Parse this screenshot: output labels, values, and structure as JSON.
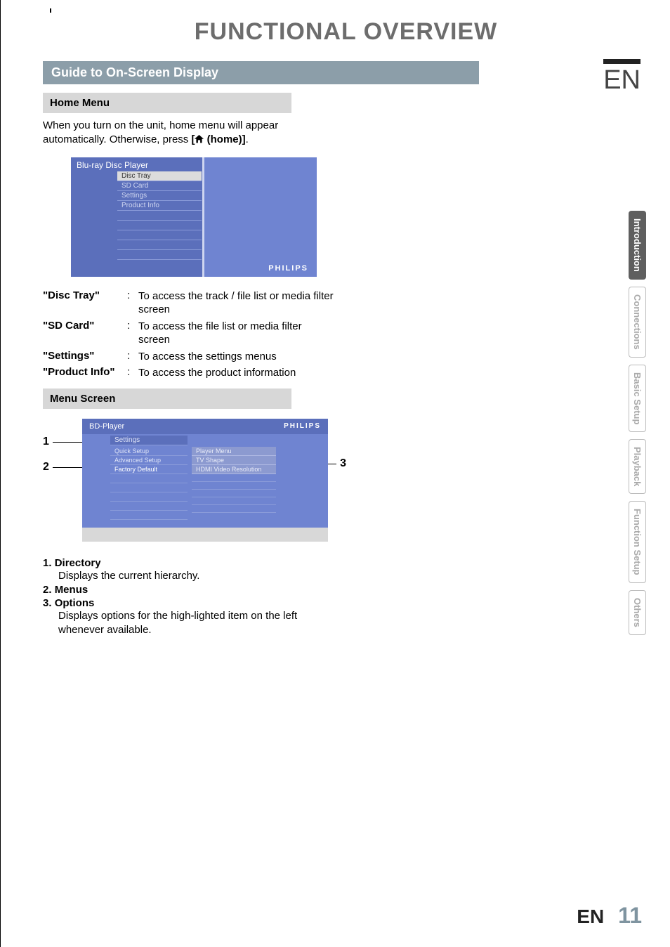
{
  "page": {
    "title": "FUNCTIONAL OVERVIEW",
    "lang": "EN",
    "section_bar": "Guide to On-Screen Display",
    "footer_lang": "EN",
    "footer_page": "11"
  },
  "home_menu": {
    "heading": "Home Menu",
    "intro_a": "When you turn on the unit, home menu will appear automatically. Otherwise, press ",
    "intro_b": "[",
    "intro_c": " (home)]",
    "intro_d": ".",
    "screen": {
      "title": "Blu-ray Disc Player",
      "items": [
        "Disc Tray",
        "SD Card",
        "Settings",
        "Product Info"
      ],
      "brand": "PHILIPS"
    },
    "defs": [
      {
        "term": "\"Disc Tray\"",
        "desc": "To access the track / file list or media filter screen"
      },
      {
        "term": "\"SD Card\"",
        "desc": "To access the file list or media filter screen"
      },
      {
        "term": "\"Settings\"",
        "desc": "To access the settings menus"
      },
      {
        "term": "\"Product Info\"",
        "desc": "To access the product information"
      }
    ]
  },
  "menu_screen": {
    "heading": "Menu Screen",
    "screen": {
      "top_left": "BD-Player",
      "brand": "PHILIPS",
      "crumb": "Settings",
      "left_rows": [
        "Quick Setup",
        "Advanced Setup",
        "Factory Default"
      ],
      "right_rows": [
        "Player Menu",
        "TV Shape",
        "HDMI Video Resolution"
      ]
    },
    "callouts": {
      "c1": "1",
      "c2": "2",
      "c3": "3"
    },
    "list": [
      {
        "num": "1.",
        "term": "Directory",
        "desc": "Displays the current hierarchy."
      },
      {
        "num": "2.",
        "term": "Menus",
        "desc": ""
      },
      {
        "num": "3.",
        "term": "Options",
        "desc": "Displays options for the high-lighted item on the left whenever available."
      }
    ]
  },
  "tabs": [
    "Introduction",
    "Connections",
    "Basic Setup",
    "Playback",
    "Function Setup",
    "Others"
  ]
}
